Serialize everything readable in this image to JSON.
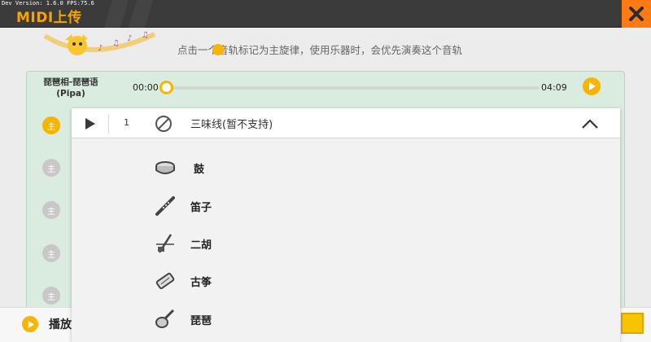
{
  "dev": {
    "text": "Dev Version: 1.6.0  FPS:75.6"
  },
  "header": {
    "title": "MIDI上传"
  },
  "hint": {
    "text": "点击一个音轨标记为主旋律，使用乐器时，会优先演奏这个音轨"
  },
  "song": {
    "name": "琵琶相-琵琶语",
    "subtitle": "(Pipa)",
    "time_start": "00:00",
    "time_end": "04:09",
    "progress": 0.0
  },
  "tracks": [
    {
      "label": "主",
      "active": true
    },
    {
      "label": "主",
      "active": false
    },
    {
      "label": "主",
      "active": false
    },
    {
      "label": "主",
      "active": false
    },
    {
      "label": "主",
      "active": false
    }
  ],
  "dropdown": {
    "track_number": "1",
    "selected": "三味线(暂不支持)",
    "options": [
      {
        "label": "鼓",
        "icon": "drum-icon"
      },
      {
        "label": "笛子",
        "icon": "flute-icon"
      },
      {
        "label": "二胡",
        "icon": "erhu-icon"
      },
      {
        "label": "古筝",
        "icon": "guzheng-icon"
      },
      {
        "label": "琵琶",
        "icon": "pipa-icon"
      }
    ]
  },
  "bottom": {
    "play_label": "播放"
  },
  "colors": {
    "accent": "#f7b500",
    "close": "#ff7a12",
    "topbar": "#3b3b3b",
    "panel": "#d9ecdf"
  }
}
